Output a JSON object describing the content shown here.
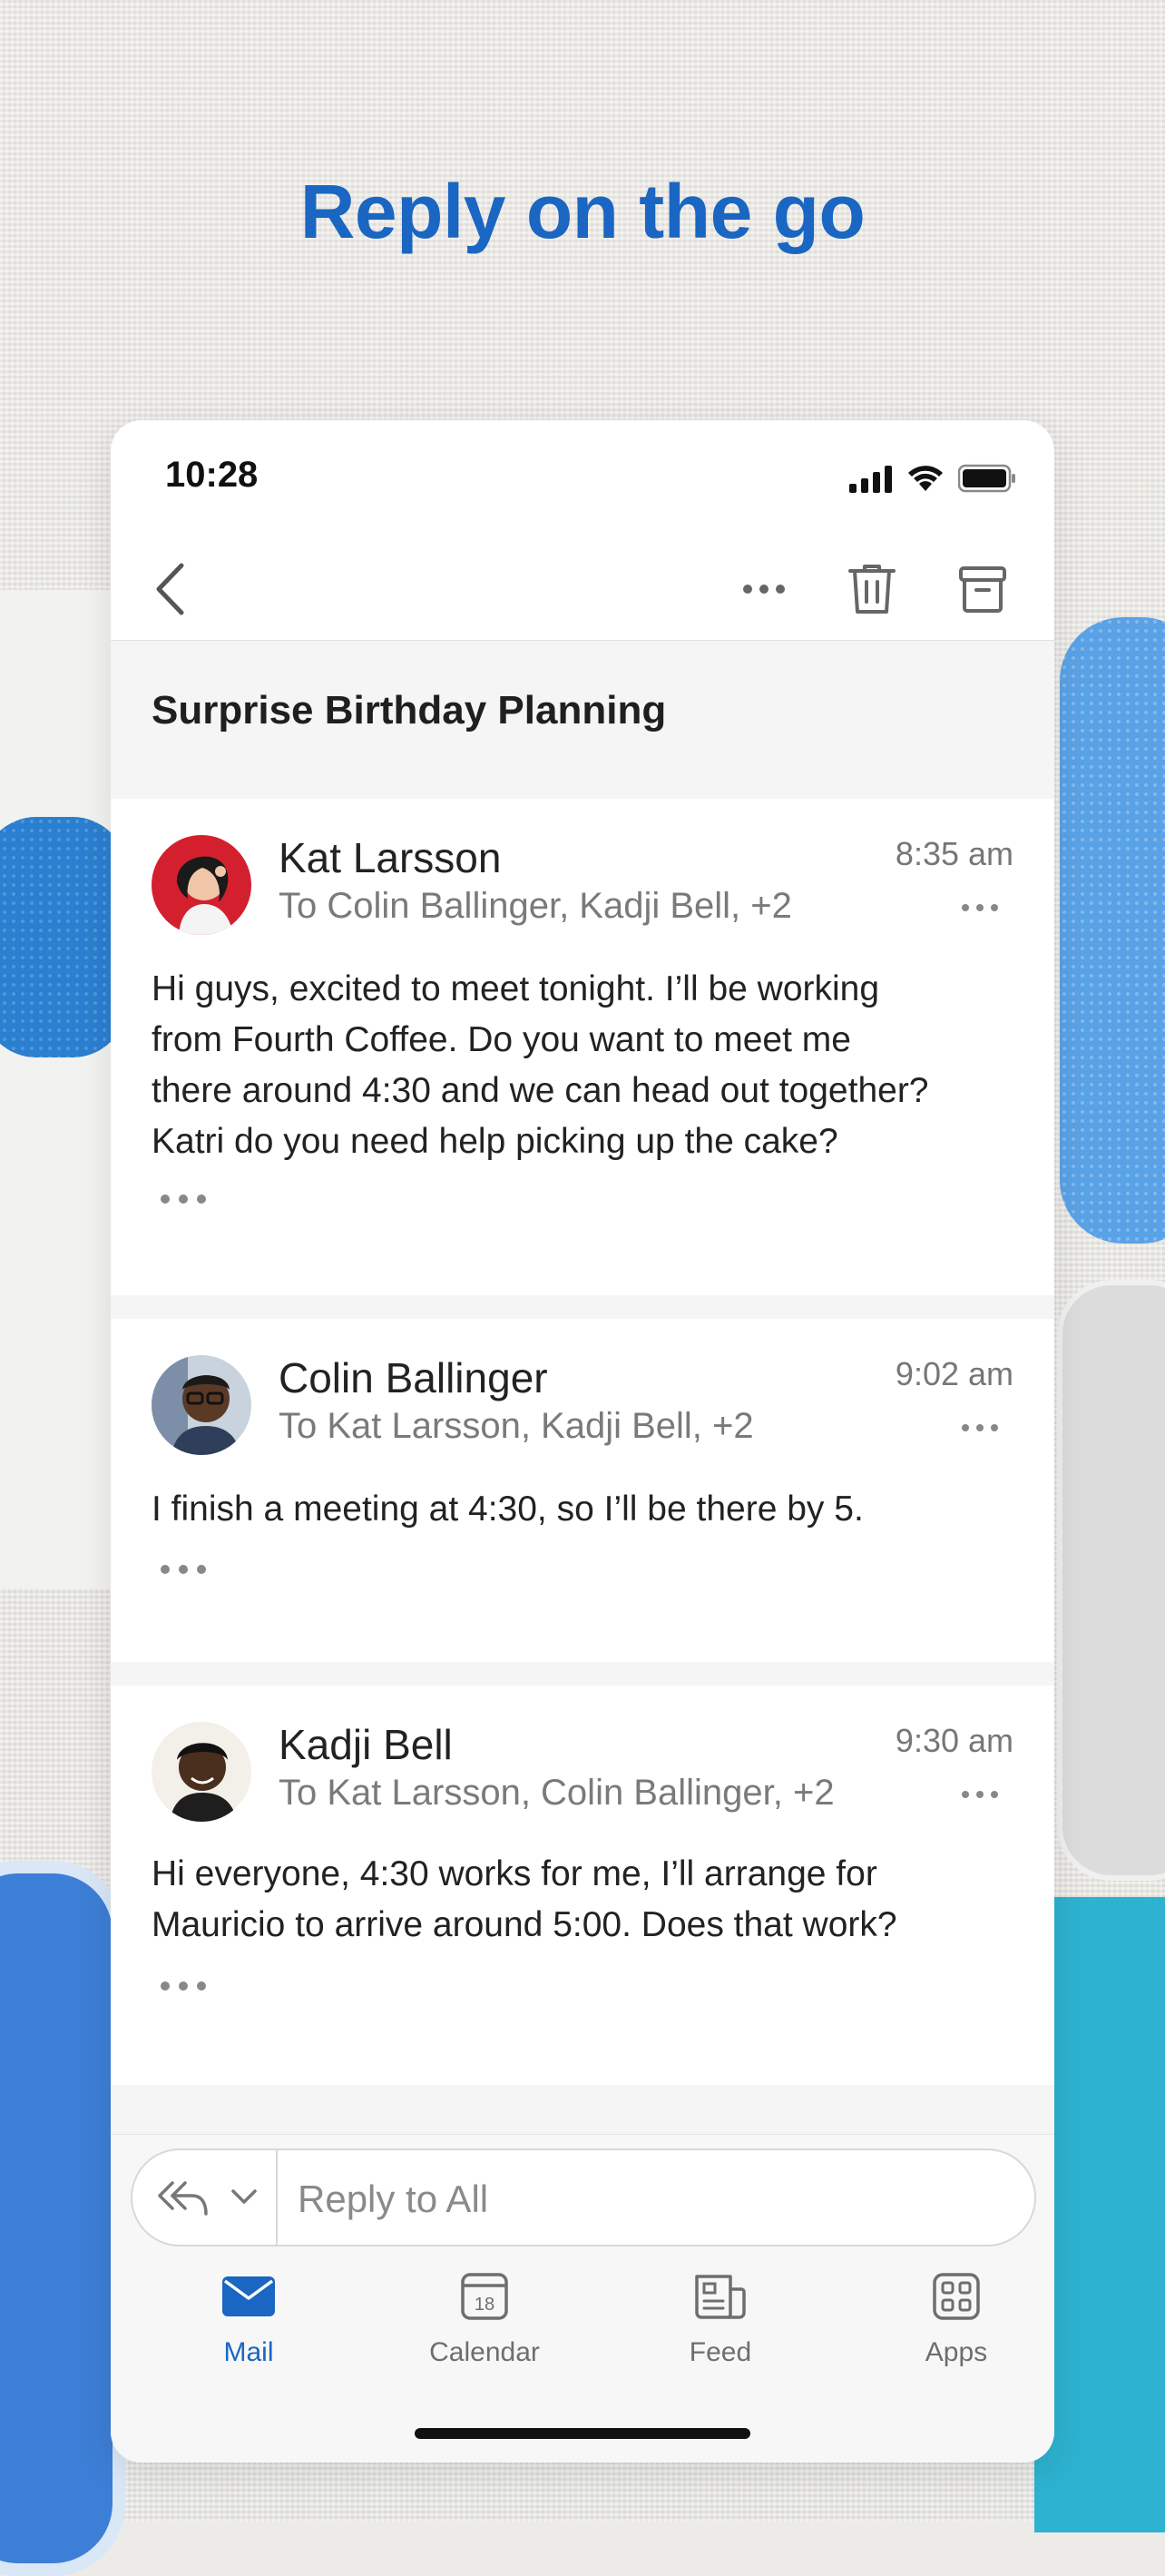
{
  "headline": "Reply on the go",
  "status": {
    "time": "10:28"
  },
  "toolbar": {
    "back": "back-icon",
    "more": "more-icon",
    "delete": "trash-icon",
    "archive": "archive-icon"
  },
  "thread": {
    "subject": "Surprise Birthday Planning"
  },
  "messages": [
    {
      "sender": "Kat Larsson",
      "recipients": "To Colin Ballinger, Kadji Bell, +2",
      "time": "8:35 am",
      "body_lines": [
        "Hi guys, excited to meet tonight. I’ll be working",
        "from Fourth Coffee. Do you want to meet me",
        "there around 4:30 and we can head out together?",
        "Katri do you need help picking up the cake?"
      ]
    },
    {
      "sender": "Colin Ballinger",
      "recipients": "To Kat Larsson, Kadji Bell, +2",
      "time": "9:02 am",
      "body_lines": [
        "I finish a meeting at 4:30, so I’ll be there by 5."
      ]
    },
    {
      "sender": "Kadji Bell",
      "recipients": "To Kat Larsson, Colin Ballinger, +2",
      "time": "9:30 am",
      "body_lines": [
        "Hi everyone, 4:30 works for me, I’ll arrange for",
        "Mauricio to arrive around 5:00. Does that work?"
      ]
    }
  ],
  "compose": {
    "placeholder": "Reply to All"
  },
  "tabs": [
    {
      "label": "Mail",
      "icon": "mail-icon",
      "active": true
    },
    {
      "label": "Calendar",
      "icon": "calendar-icon",
      "calendar_day": "18"
    },
    {
      "label": "Feed",
      "icon": "feed-icon"
    },
    {
      "label": "Apps",
      "icon": "apps-icon"
    }
  ],
  "colors": {
    "accent": "#1a66c2",
    "text": "#222222",
    "muted": "#7a7a7a"
  }
}
